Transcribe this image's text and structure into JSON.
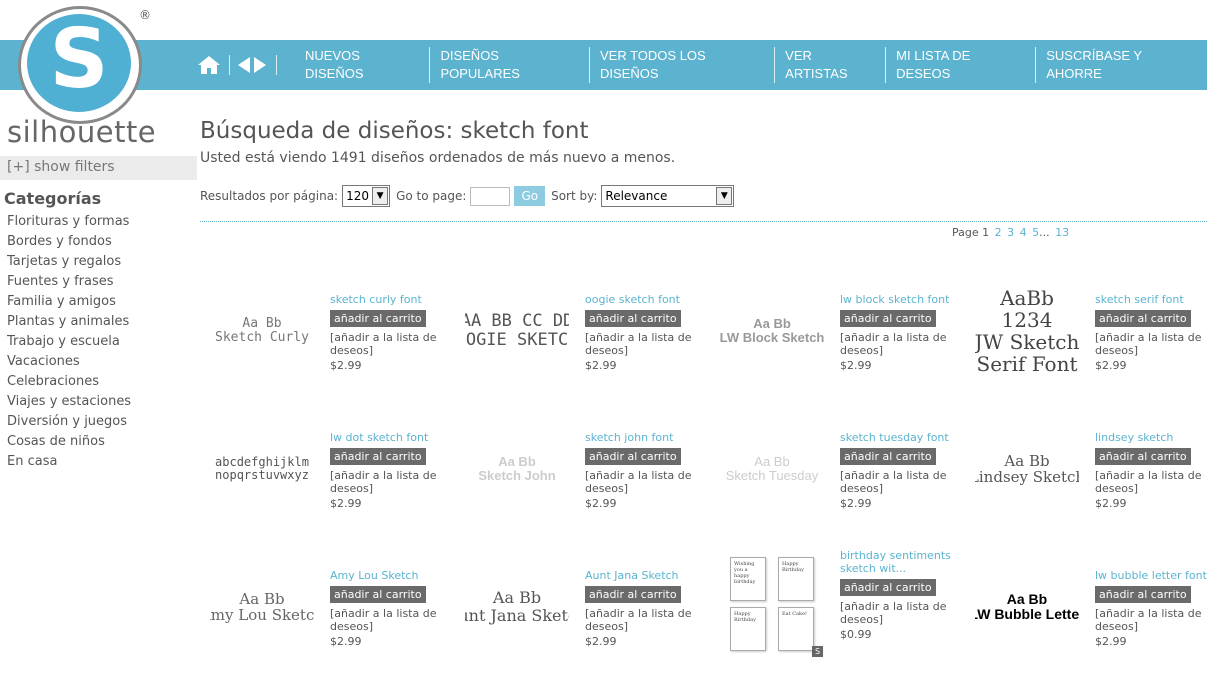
{
  "brand": {
    "name": "silhouette",
    "reg": "®",
    "logo_letter": "S"
  },
  "nav": [
    "NUEVOS DISEÑOS",
    "DISEÑOS POPULARES",
    "VER TODOS LOS DISEÑOS",
    "VER ARTISTAS",
    "MI LISTA DE DESEOS",
    "SUSCRÍBASE Y AHORRE"
  ],
  "sidebar": {
    "filters": "[+] show filters",
    "title": "Categorías",
    "categories": [
      "Florituras y formas",
      "Bordes y fondos",
      "Tarjetas y regalos",
      "Fuentes y frases",
      "Familia y amigos",
      "Plantas y animales",
      "Trabajo y escuela",
      "Vacaciones",
      "Celebraciones",
      "Viajes y estaciones",
      "Diversión y juegos",
      "Cosas de niños",
      "En casa"
    ]
  },
  "main": {
    "title": "Búsqueda de diseños: sketch font",
    "subtitle": "Usted está viendo 1491 diseños ordenados de más nuevo a menos.",
    "per_page_label": "Resultados por página:",
    "per_page_value": "120",
    "goto_label": "Go to page:",
    "go_button": "Go",
    "sort_label": "Sort by:",
    "sort_value": "Relevance",
    "pager": {
      "label": "Page",
      "current": "1",
      "pages": [
        "2",
        "3",
        "4",
        "5"
      ],
      "ellipsis": "...",
      "last": "13"
    }
  },
  "colors": {
    "accent": "#5bb3d0",
    "cart": "#6a6a6a"
  },
  "products": [
    {
      "name": "sketch curly font",
      "thumb": "Aa Bb\nSketch Curly",
      "price": "$2.99"
    },
    {
      "name": "oogie sketch font",
      "thumb": "AA BB CC DD\nOOGIE SKETCH",
      "price": "$2.99"
    },
    {
      "name": "lw block sketch font",
      "thumb": "Aa Bb\nLW Block Sketch",
      "price": "$2.99"
    },
    {
      "name": "sketch serif font",
      "thumb": "AaBb\n1234\nJW Sketch\nSerif Font",
      "price": "$2.99"
    },
    {
      "name": "lw dot sketch font",
      "thumb": "abcdefghijklm\nnopqrstuvwxyz",
      "price": "$2.99"
    },
    {
      "name": "sketch john font",
      "thumb": "Aa Bb\nSketch John",
      "price": "$2.99"
    },
    {
      "name": "sketch tuesday font",
      "thumb": "Aa Bb\nSketch Tuesday",
      "price": "$2.99"
    },
    {
      "name": "lindsey sketch",
      "thumb": "Aa Bb\nLindsey Sketch",
      "price": "$2.99"
    },
    {
      "name": "Amy Lou Sketch",
      "thumb": "Aa Bb\nAmy Lou Sketch",
      "price": "$2.99"
    },
    {
      "name": "Aunt Jana Sketch",
      "thumb": "Aa Bb\nAunt Jana Sketch",
      "price": "$2.99"
    },
    {
      "name": "birthday sentiments sketch wit...",
      "thumb": "",
      "price": "$0.99",
      "cards": [
        "Wishing you a happy birthday",
        "Happy Birthday",
        "Happy Birthday",
        "Eat Cake!"
      ],
      "badge": "S"
    },
    {
      "name": "lw bubble letter font",
      "thumb": "Aa Bb\nLW Bubble Letter",
      "price": "$2.99"
    }
  ],
  "labels": {
    "cart": "añadir al carrito",
    "wish": "[añadir a la lista de deseos]"
  }
}
